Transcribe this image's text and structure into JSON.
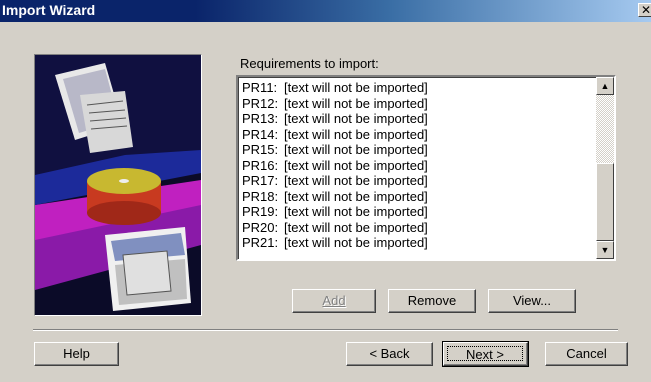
{
  "window": {
    "title": "Import Wizard",
    "close_glyph": "✕"
  },
  "requirements": {
    "label": "Requirements to import:",
    "items": [
      {
        "code": "PR11:",
        "text": "[text will not be imported]"
      },
      {
        "code": "PR12:",
        "text": "[text will not be imported]"
      },
      {
        "code": "PR13:",
        "text": "[text will not be imported]"
      },
      {
        "code": "PR14:",
        "text": "[text will not be imported]"
      },
      {
        "code": "PR15:",
        "text": "[text will not be imported]"
      },
      {
        "code": "PR16:",
        "text": "[text will not be imported]"
      },
      {
        "code": "PR17:",
        "text": "[text will not be imported]"
      },
      {
        "code": "PR18:",
        "text": "[text will not be imported]"
      },
      {
        "code": "PR19:",
        "text": "[text will not be imported]"
      },
      {
        "code": "PR20:",
        "text": "[text will not be imported]"
      },
      {
        "code": "PR21:",
        "text": "[text will not be imported]"
      }
    ]
  },
  "actions": {
    "add_label": "Add",
    "remove_label": "Remove",
    "view_label": "View..."
  },
  "footer": {
    "help_label": "Help",
    "back_label": "< Back",
    "next_label": "Next >",
    "cancel_label": "Cancel"
  },
  "scrollbar": {
    "up_glyph": "▲",
    "down_glyph": "▼"
  },
  "colors": {
    "dialog_bg": "#d4d0c8",
    "title_start": "#0a246a",
    "title_end": "#a6caf0"
  }
}
